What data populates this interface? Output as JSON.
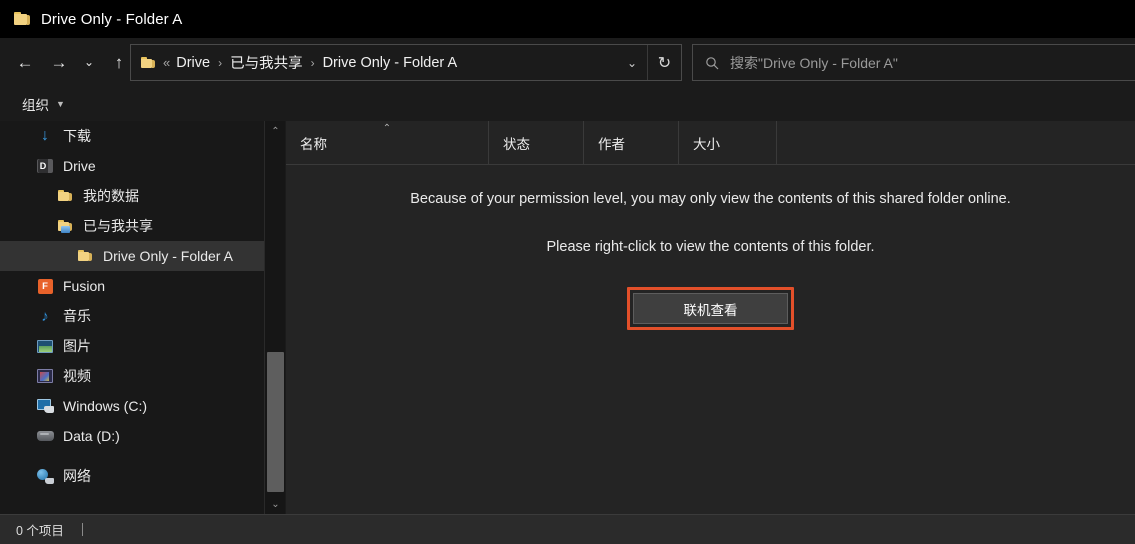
{
  "window": {
    "title": "Drive Only - Folder A",
    "title_icon": "folder-icon"
  },
  "nav": {
    "back_icon": "←",
    "forward_icon": "→",
    "history_icon": "⌄",
    "up_icon": "↑",
    "refresh_icon": "↻",
    "address_caret_icon": "⌄"
  },
  "address": {
    "folder_icon": "folder-icon",
    "overflow": "«",
    "crumbs": [
      {
        "label": "Drive"
      },
      {
        "label": "已与我共享"
      },
      {
        "label": "Drive Only - Folder A"
      }
    ],
    "separator": "›"
  },
  "search": {
    "icon": "search-icon",
    "placeholder": "搜索\"Drive Only - Folder A\""
  },
  "toolbar": {
    "organize_label": "组织",
    "caret": "▼"
  },
  "sidebar": {
    "items": [
      {
        "label": "下载",
        "icon": "download-icon",
        "indent": 0,
        "selected": false
      },
      {
        "label": "Drive",
        "icon": "drive-icon",
        "indent": 0,
        "selected": false
      },
      {
        "label": "我的数据",
        "icon": "folder-icon",
        "indent": 1,
        "selected": false
      },
      {
        "label": "已与我共享",
        "icon": "shared-folder-icon",
        "indent": 1,
        "selected": false
      },
      {
        "label": "Drive Only - Folder A",
        "icon": "folder-icon",
        "indent": 2,
        "selected": true
      },
      {
        "label": "Fusion",
        "icon": "fusion-icon",
        "indent": 0,
        "selected": false
      },
      {
        "label": "音乐",
        "icon": "music-icon",
        "indent": 0,
        "selected": false
      },
      {
        "label": "图片",
        "icon": "pictures-icon",
        "indent": 0,
        "selected": false
      },
      {
        "label": "视频",
        "icon": "videos-icon",
        "indent": 0,
        "selected": false
      },
      {
        "label": "Windows (C:)",
        "icon": "windows-drive-icon",
        "indent": 0,
        "selected": false
      },
      {
        "label": "Data (D:)",
        "icon": "hard-drive-icon",
        "indent": 0,
        "selected": false
      },
      {
        "label": "网络",
        "icon": "network-icon",
        "indent": 0,
        "selected": false
      }
    ],
    "scroll_up_icon": "⌃",
    "scroll_down_icon": "⌄"
  },
  "columns": [
    {
      "label": "名称",
      "sorted": "asc",
      "sort_caret": "⌃"
    },
    {
      "label": "状态",
      "sorted": "",
      "sort_caret": ""
    },
    {
      "label": "作者",
      "sorted": "",
      "sort_caret": ""
    },
    {
      "label": "大小",
      "sorted": "",
      "sort_caret": ""
    }
  ],
  "main": {
    "message_line1": "Because of your permission level, you may only view the contents of this shared folder online.",
    "message_line2": "Please right-click to view the contents of this folder.",
    "online_button_label": "联机查看"
  },
  "status": {
    "item_count_text": "0 个项目"
  },
  "colors": {
    "highlight": "#e3502a",
    "window_bg": "#1b1b1b",
    "sidebar_bg": "#181818",
    "content_bg": "#242424",
    "selection": "#333333",
    "folder_yellow": "#f2d281"
  }
}
